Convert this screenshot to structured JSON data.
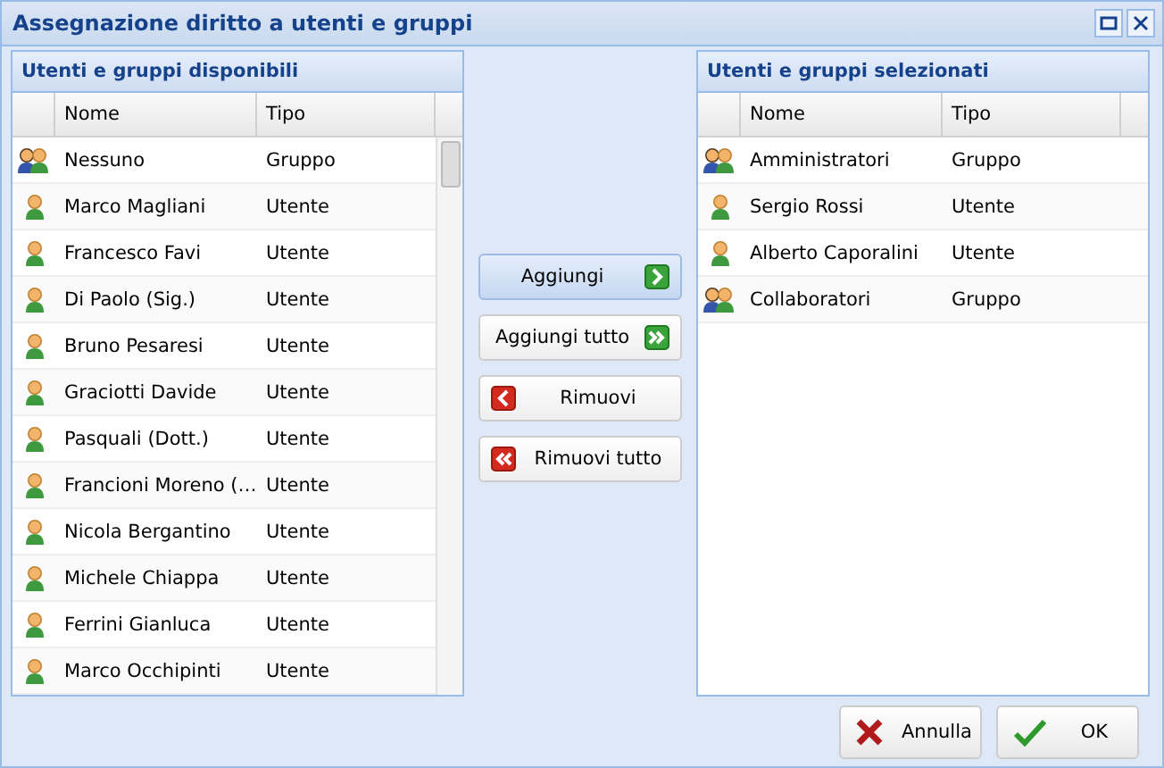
{
  "window": {
    "title": "Assegnazione diritto a utenti e gruppi"
  },
  "available": {
    "title": "Utenti e gruppi disponibili",
    "columns": [
      "Nome",
      "Tipo"
    ],
    "rows": [
      {
        "kind": "group",
        "name": "Nessuno",
        "type": "Gruppo"
      },
      {
        "kind": "user",
        "name": "Marco Magliani",
        "type": "Utente"
      },
      {
        "kind": "user",
        "name": "Francesco Favi",
        "type": "Utente"
      },
      {
        "kind": "user",
        "name": "Di Paolo (Sig.)",
        "type": "Utente"
      },
      {
        "kind": "user",
        "name": "Bruno Pesaresi",
        "type": "Utente"
      },
      {
        "kind": "user",
        "name": "Graciotti Davide",
        "type": "Utente"
      },
      {
        "kind": "user",
        "name": "Pasquali (Dott.)",
        "type": "Utente"
      },
      {
        "kind": "user",
        "name": "Francioni Moreno (…",
        "type": "Utente"
      },
      {
        "kind": "user",
        "name": "Nicola Bergantino",
        "type": "Utente"
      },
      {
        "kind": "user",
        "name": "Michele Chiappa",
        "type": "Utente"
      },
      {
        "kind": "user",
        "name": "Ferrini Gianluca",
        "type": "Utente"
      },
      {
        "kind": "user",
        "name": "Marco Occhipinti",
        "type": "Utente"
      }
    ]
  },
  "actions": [
    {
      "kind": "add",
      "label": "Aggiungi",
      "highlighted": true
    },
    {
      "kind": "add-all",
      "label": "Aggiungi tutto",
      "highlighted": false
    },
    {
      "kind": "remove",
      "label": "Rimuovi",
      "highlighted": false
    },
    {
      "kind": "remove-all",
      "label": "Rimuovi tutto",
      "highlighted": false
    }
  ],
  "selected": {
    "title": "Utenti e gruppi selezionati",
    "columns": [
      "Nome",
      "Tipo"
    ],
    "rows": [
      {
        "kind": "group",
        "name": "Amministratori",
        "type": "Gruppo"
      },
      {
        "kind": "user",
        "name": "Sergio Rossi",
        "type": "Utente"
      },
      {
        "kind": "user",
        "name": "Alberto Caporalini",
        "type": "Utente"
      },
      {
        "kind": "group",
        "name": "Collaboratori",
        "type": "Gruppo"
      }
    ]
  },
  "buttons": [
    {
      "kind": "cancel",
      "label": "Annulla"
    },
    {
      "kind": "ok",
      "label": "OK"
    }
  ]
}
